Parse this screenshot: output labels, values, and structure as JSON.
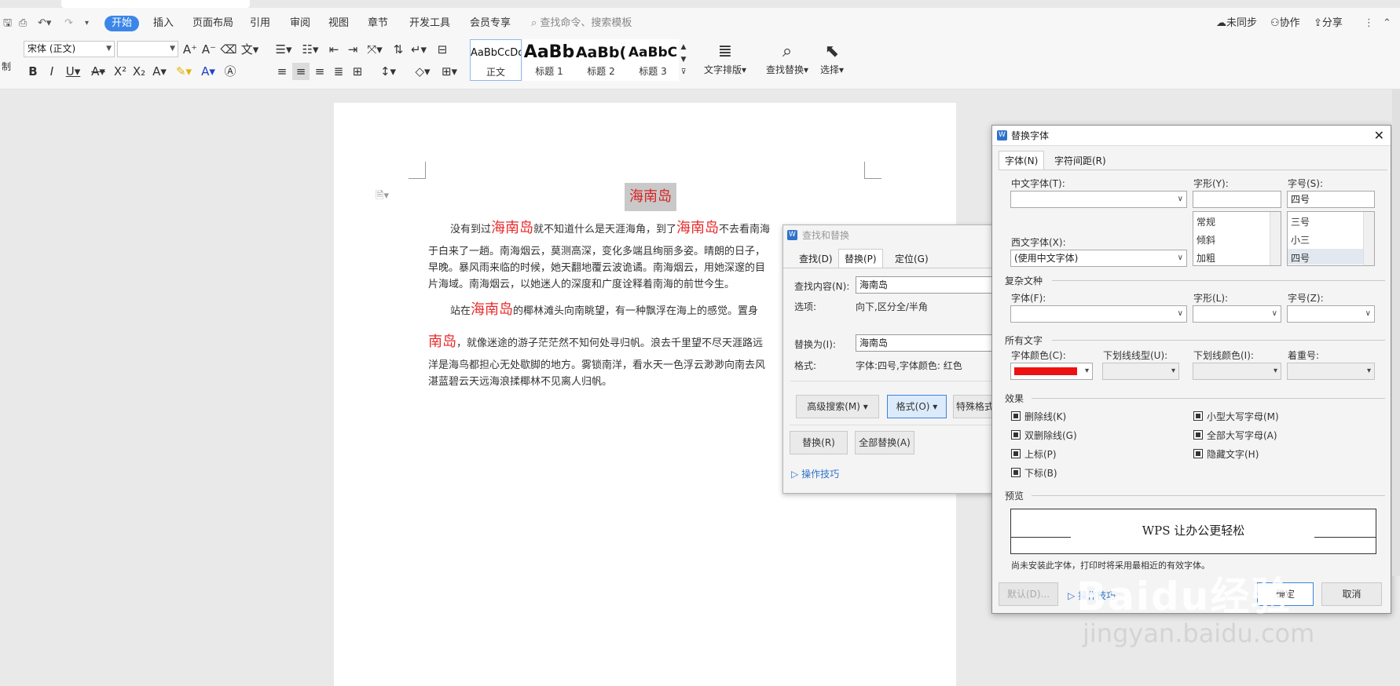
{
  "menu": {
    "items": [
      "开始",
      "插入",
      "页面布局",
      "引用",
      "审阅",
      "视图",
      "章节",
      "开发工具",
      "会员专享"
    ],
    "search_placeholder": "查找命令、搜索模板",
    "right": [
      "未同步",
      "协作",
      "分享"
    ]
  },
  "ribbon": {
    "font_name": "宋体 (正文)",
    "font_size": "",
    "styles": [
      {
        "sample": "AaBbCcDd",
        "name": "正文"
      },
      {
        "sample": "AaBb",
        "name": "标题 1"
      },
      {
        "sample": "AaBb(",
        "name": "标题 2"
      },
      {
        "sample": "AaBbC",
        "name": "标题 3"
      }
    ],
    "text_layout": "文字排版",
    "find_replace": "查找替换",
    "select": "选择",
    "left_stub": "制"
  },
  "document": {
    "title": "海南岛",
    "p1": {
      "a": "没有到过",
      "b": "海南岛",
      "c": "就不知道什么是天涯海角，到了",
      "d": "海南岛",
      "e": "不去看南海"
    },
    "line2": "于白来了一趟。南海烟云，莫测高深，变化多端且绚丽多姿。晴朗的日子，",
    "line3": "早晚。暴风雨来临的时候，她天翻地覆云波诡谲。南海烟云，用她深邃的目",
    "line4": "片海域。南海烟云，以她迷人的深度和广度诠释着南海的前世今生。",
    "p2": {
      "a": "站在",
      "b": "海南岛",
      "c": "的椰林滩头向南眺望，有一种飘浮在海上的感觉。置身"
    },
    "line6": {
      "a": "南岛",
      "b": "，就像迷途的游子茫茫然不知何处寻归帆。浪去千里望不尽天涯路远"
    },
    "line7": "洋是海鸟都担心无处歇脚的地方。雾锁南洋，看水天一色浮云渺渺向南去风",
    "line8": "湛蓝碧云天远海浪揉椰林不见离人归帆。"
  },
  "find_replace": {
    "title": "查找和替换",
    "tabs": [
      "查找(D)",
      "替换(P)",
      "定位(G)"
    ],
    "find_label": "查找内容(N):",
    "find_value": "海南岛",
    "options_label": "选项:",
    "options_value": "向下,区分全/半角",
    "replace_label": "替换为(I):",
    "replace_value": "海南岛",
    "format_label": "格式:",
    "format_value": "字体:四号,字体颜色: 红色",
    "advanced": "高级搜索(M)",
    "format_btn": "格式(O)",
    "special_btn": "特殊格式",
    "replace_btn": "替换(R)",
    "replace_all_btn": "全部替换(A)",
    "tips": "操作技巧"
  },
  "replace_font": {
    "title": "替换字体",
    "tabs": [
      "字体(N)",
      "字符间距(R)"
    ],
    "cn_font_label": "中文字体(T):",
    "cn_font_value": "",
    "style_label": "字形(Y):",
    "style_value": "",
    "style_list": [
      "常规",
      "倾斜",
      "加粗"
    ],
    "size_label": "字号(S):",
    "size_value": "四号",
    "size_list": [
      "三号",
      "小三",
      "四号"
    ],
    "west_font_label": "西文字体(X):",
    "west_font_value": "(使用中文字体)",
    "complex_section": "复杂文种",
    "complex_font_label": "字体(F):",
    "complex_style_label": "字形(L):",
    "complex_size_label": "字号(Z):",
    "all_text_section": "所有文字",
    "color_label": "字体颜色(C):",
    "color_value": "#ee1111",
    "underline_label": "下划线线型(U):",
    "underline_color_label": "下划线颜色(I):",
    "emphasis_label": "着重号:",
    "effects_section": "效果",
    "effects_left": [
      "删除线(K)",
      "双删除线(G)",
      "上标(P)",
      "下标(B)"
    ],
    "effects_right": [
      "小型大写字母(M)",
      "全部大写字母(A)",
      "隐藏文字(H)"
    ],
    "preview_section": "预览",
    "preview_text": "WPS 让办公更轻松",
    "preview_note": "尚未安装此字体，打印时将采用最相近的有效字体。",
    "default_btn": "默认(D)...",
    "tips": "操作技巧",
    "ok_btn": "确定",
    "cancel_btn": "取消"
  },
  "watermark": {
    "logo": "Baidu经验",
    "url": "jingyan.baidu.com"
  }
}
